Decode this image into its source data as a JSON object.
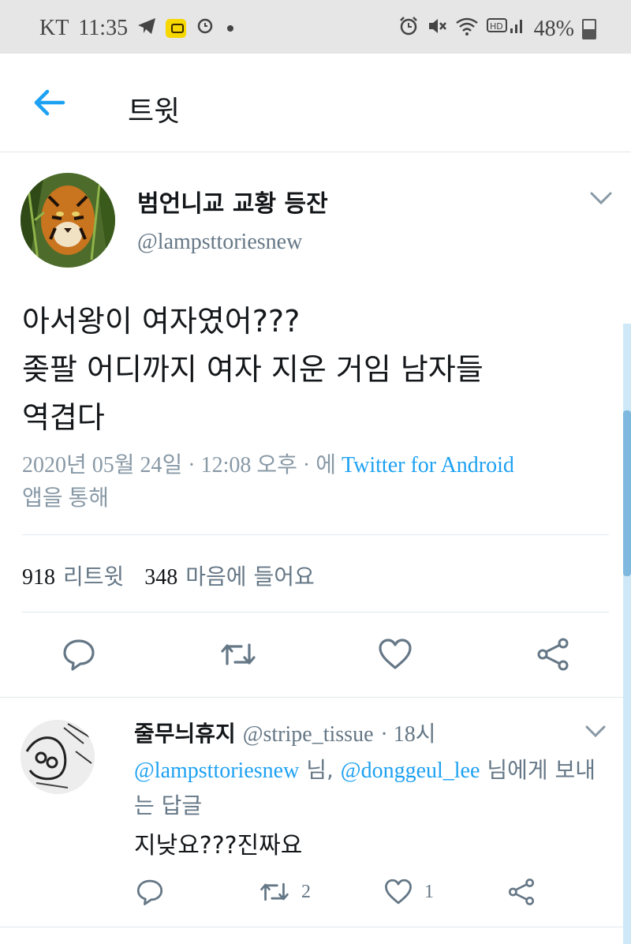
{
  "status_bar": {
    "carrier": "KT",
    "time": "11:35",
    "battery": "48%"
  },
  "header": {
    "title": "트윗"
  },
  "tweet": {
    "display_name": "범언니교 교황 등잔",
    "handle": "@lampsttoriesnew",
    "text_lines": [
      "아서왕이 여자였어???",
      "좆팔 어디까지 여자 지운 거임 남자들",
      "역겹다"
    ],
    "timestamp": "2020년 05월 24일 · 12:08 오후 · 에",
    "source": "Twitter for Android",
    "via": "앱을 통해",
    "retweets_count": "918",
    "retweets_label": "리트윗",
    "likes_count": "348",
    "likes_label": "마음에 들어요"
  },
  "reply": {
    "display_name": "줄무늬휴지",
    "handle": "@stripe_tissue",
    "time": "· 18시",
    "mention1": "@lampsttoriesnew",
    "mention_sep": " 님, ",
    "mention2": "@donggeul_lee",
    "reply_suffix": " 님에게 보내는 답글",
    "text": "지낮요???진짜요",
    "retweet_count": "2",
    "like_count": "1"
  },
  "colors": {
    "accent": "#1da1f2",
    "secondary_text": "#657786",
    "status_bar_bg": "#e6e6e6"
  },
  "icons": [
    "back-arrow-icon",
    "chevron-down-icon",
    "reply-icon",
    "retweet-icon",
    "heart-icon",
    "share-icon"
  ]
}
